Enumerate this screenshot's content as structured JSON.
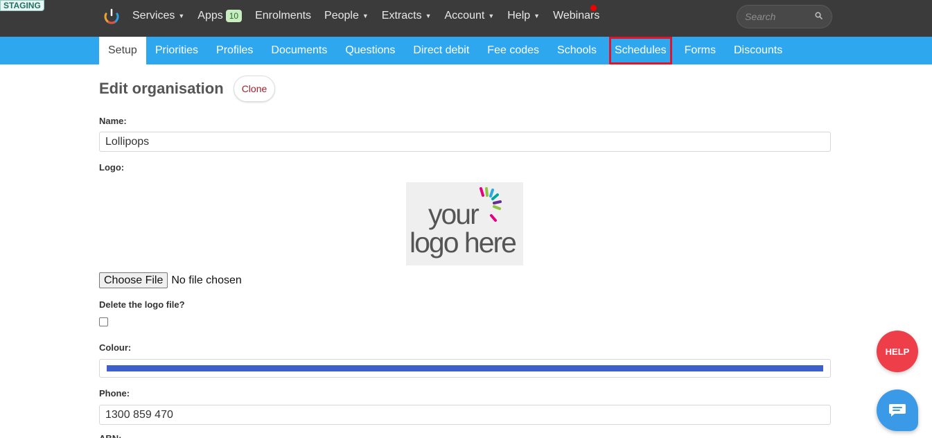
{
  "env_badge": "STAGING",
  "topnav": {
    "items": [
      {
        "label": "Services",
        "dropdown": true
      },
      {
        "label": "Apps",
        "badge": "10"
      },
      {
        "label": "Enrolments"
      },
      {
        "label": "People",
        "dropdown": true
      },
      {
        "label": "Extracts",
        "dropdown": true
      },
      {
        "label": "Account",
        "dropdown": true
      },
      {
        "label": "Help",
        "dropdown": true
      },
      {
        "label": "Webinars",
        "notification": true
      }
    ],
    "search_placeholder": "Search"
  },
  "subnav": {
    "tabs": [
      {
        "label": "Setup",
        "active": true
      },
      {
        "label": "Priorities"
      },
      {
        "label": "Profiles"
      },
      {
        "label": "Documents"
      },
      {
        "label": "Questions"
      },
      {
        "label": "Direct debit"
      },
      {
        "label": "Fee codes"
      },
      {
        "label": "Schools"
      },
      {
        "label": "Schedules",
        "highlighted": true
      },
      {
        "label": "Forms"
      },
      {
        "label": "Discounts"
      }
    ]
  },
  "page": {
    "title": "Edit organisation",
    "clone_label": "Clone"
  },
  "form": {
    "name_label": "Name:",
    "name_value": "Lollipops",
    "logo_label": "Logo:",
    "logo_text_line1": "your",
    "logo_text_line2": "logo here",
    "choose_file_label": "Choose File",
    "file_status": "No file chosen",
    "delete_logo_label": "Delete the logo file?",
    "delete_logo_checked": false,
    "colour_label": "Colour:",
    "colour_value": "#3d5fcc",
    "phone_label": "Phone:",
    "phone_value": "1300 859 470",
    "next_label": "ABN:"
  },
  "widgets": {
    "help_label": "HELP"
  },
  "colors": {
    "topbar": "#3b3b3b",
    "subnav": "#2fa7ef",
    "highlight_outline": "#e0152c",
    "help": "#ee3e4a",
    "chat": "#3a9ae8"
  }
}
